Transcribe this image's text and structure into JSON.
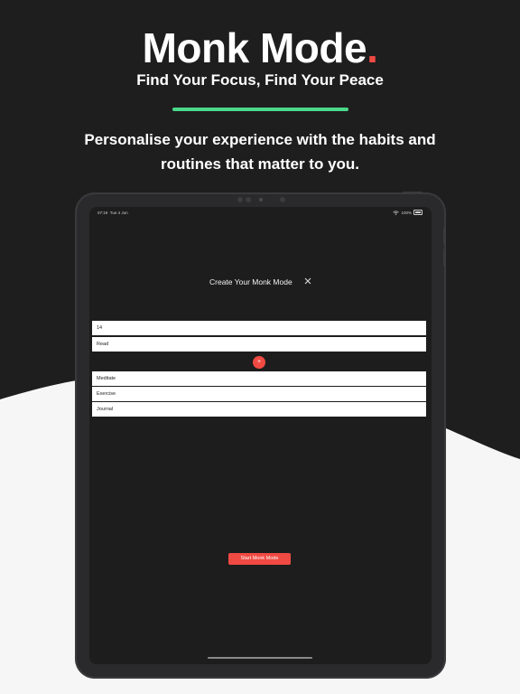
{
  "header": {
    "title": "Monk Mode",
    "title_dot": ".",
    "tagline": "Find Your Focus, Find Your Peace",
    "description": "Personalise your experience with the habits and routines that matter to you."
  },
  "colors": {
    "accent_red": "#f04a43",
    "accent_green": "#4ad98a",
    "background_dark": "#1e1e1e",
    "background_light": "#f6f6f6"
  },
  "status_bar": {
    "time": "07:19",
    "date": "Tue 4 Jun",
    "battery": "100%",
    "wifi_icon": "wifi-icon"
  },
  "dialog": {
    "title": "Create Your Monk Mode",
    "close_icon": "close-icon"
  },
  "fields": {
    "days": "14",
    "habit_1": "Read",
    "habit_2": "Meditate",
    "habit_3": "Exercise",
    "habit_4": "Journal"
  },
  "add_button": {
    "label": "+"
  },
  "start_button": {
    "label": "Start Monk Mode"
  }
}
